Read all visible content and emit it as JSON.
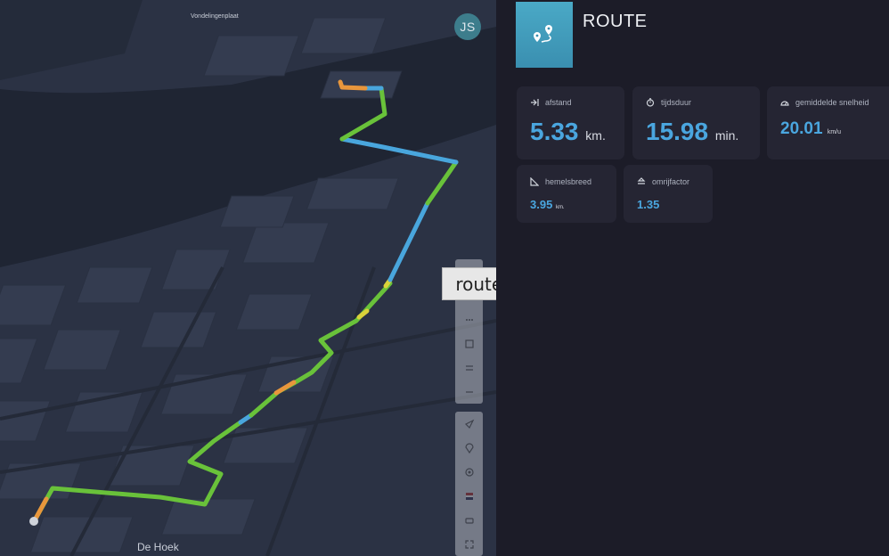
{
  "map": {
    "places": {
      "top": "Vondelingenplaat",
      "bottom": "De Hoek"
    },
    "user_initials": "JS",
    "tooltip": "routes",
    "route_colors": {
      "fast": "#49a6dd",
      "medium": "#69c23a",
      "slow": "#e8963c",
      "alt": "#d9d23a"
    }
  },
  "panel": {
    "title": "ROUTE",
    "stats": [
      {
        "label": "afstand",
        "value": "5.33",
        "unit": "km.",
        "icon": "arrow-to-line-icon"
      },
      {
        "label": "tijdsduur",
        "value": "15.98",
        "unit": "min.",
        "icon": "stopwatch-icon"
      },
      {
        "label": "gemiddelde snelheid",
        "value": "20.01",
        "unit": "km/u",
        "icon": "speedometer-icon"
      },
      {
        "label": "hemelsbreed",
        "value": "3.95",
        "unit": "km.",
        "icon": "ruler-triangle-icon"
      },
      {
        "label": "omrijfactor",
        "value": "1.35",
        "unit": "",
        "icon": "detour-icon"
      }
    ]
  },
  "colors": {
    "accent": "#4aa6df",
    "panel_bg": "#1c1c28",
    "card_bg": "#252533"
  }
}
